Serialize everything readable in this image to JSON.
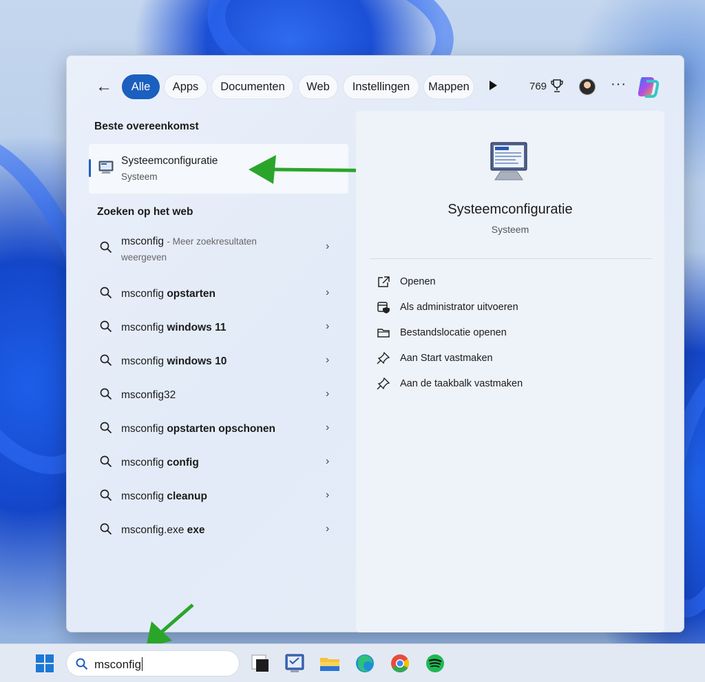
{
  "filters": {
    "back_label": "←",
    "chips": [
      "Alle",
      "Apps",
      "Documenten",
      "Web",
      "Instellingen",
      "Mappen"
    ],
    "active_index": 0,
    "points": "769",
    "more_label": "···"
  },
  "best_match": {
    "section_title": "Beste overeenkomst",
    "name": "Systeemconfiguratie",
    "type": "Systeem"
  },
  "web_search": {
    "section_title": "Zoeken op het web",
    "first": {
      "query": "msconfig",
      "hint_part1": "- Meer zoekresultaten",
      "hint_part2": "weergeven"
    },
    "items": [
      {
        "prefix": "msconfig",
        "bold": "opstarten"
      },
      {
        "prefix": "msconfig",
        "bold": "windows 11"
      },
      {
        "prefix": "msconfig",
        "bold": "windows 10"
      },
      {
        "prefix": "msconfig32",
        "bold": ""
      },
      {
        "prefix": "msconfig",
        "bold": "opstarten opschonen"
      },
      {
        "prefix": "msconfig",
        "bold": "config"
      },
      {
        "prefix": "msconfig",
        "bold": "cleanup"
      },
      {
        "prefix": "msconfig.exe",
        "bold": "exe"
      }
    ],
    "chevron": "›"
  },
  "preview": {
    "title": "Systeemconfiguratie",
    "subtitle": "Systeem",
    "actions": [
      {
        "label": "Openen",
        "icon": "open-external-icon"
      },
      {
        "label": "Als administrator uitvoeren",
        "icon": "admin-shield-icon"
      },
      {
        "label": "Bestandslocatie openen",
        "icon": "folder-icon"
      },
      {
        "label": "Aan Start vastmaken",
        "icon": "pin-icon"
      },
      {
        "label": "Aan de taakbalk vastmaken",
        "icon": "pin-icon"
      }
    ]
  },
  "taskbar": {
    "search_value": "msconfig",
    "apps": [
      "task-view-icon",
      "msconfig-app-icon",
      "file-explorer-icon",
      "edge-icon",
      "chrome-icon",
      "spotify-icon"
    ]
  },
  "colors": {
    "accent": "#1b5fbf",
    "annotation_arrow": "#2aa52a"
  }
}
